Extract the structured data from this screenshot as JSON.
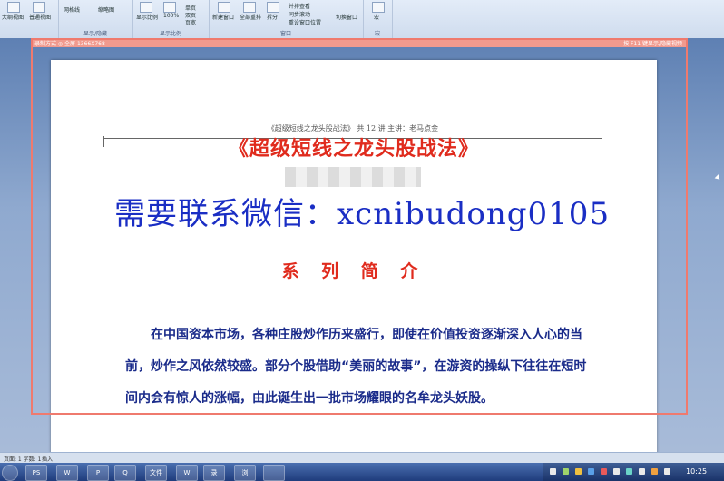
{
  "ribbon": {
    "groups": [
      {
        "label": "显示/隐藏"
      },
      {
        "label": "显示比例"
      },
      {
        "label": "窗口"
      },
      {
        "label": "宏"
      }
    ],
    "buttons": {
      "outline": "大纲视图",
      "draft": "普通视图",
      "gridlines": "网格线",
      "thumbnail": "缩略图",
      "zoom": "显示比例",
      "zoom100": "100%",
      "onepage": "单页",
      "twopage": "双页",
      "pagewidth": "页宽",
      "newwindow": "新建窗口",
      "arrangeall": "全部重排",
      "split": "拆分",
      "sidebyside": "并排查看",
      "syncscroll": "同步滚动",
      "resetpos": "重设窗口位置",
      "switchwindow": "切换窗口",
      "macro": "宏"
    }
  },
  "overlay": {
    "left_text": "录制方式  ◎ 全屏  1366X768",
    "right_text": "按 F11 键显示/隐藏视频"
  },
  "document": {
    "header": "《超级短线之龙头股战法》 共 12 讲  主讲：老马点金",
    "title": "《超级短线之龙头股战法》",
    "wechat": "需要联系微信：xcnibudong0105",
    "series_title": "系 列 简 介",
    "paragraph": "在中国资本市场，各种庄股炒作历来盛行，即使在价值投资逐渐深入人心的当前，炒作之风依然较盛。部分个股借助“美丽的故事”，在游资的操纵下往往在短时间内会有惊人的涨幅，由此诞生出一批市场耀眼的名牟龙头妖股。"
  },
  "statusbar": {
    "left": "页面: 1  字数: 1",
    "lang": "插入"
  },
  "taskbar": {
    "items": [
      "PS",
      "W",
      "P",
      "Q",
      "文件",
      "W",
      "录",
      "浏"
    ],
    "clock": "10:25"
  },
  "colors": {
    "title_red": "#e02b1d",
    "wechat_blue": "#1a2ec4",
    "para_blue": "#1a2b8a",
    "overlay": "#ef7a6e"
  }
}
